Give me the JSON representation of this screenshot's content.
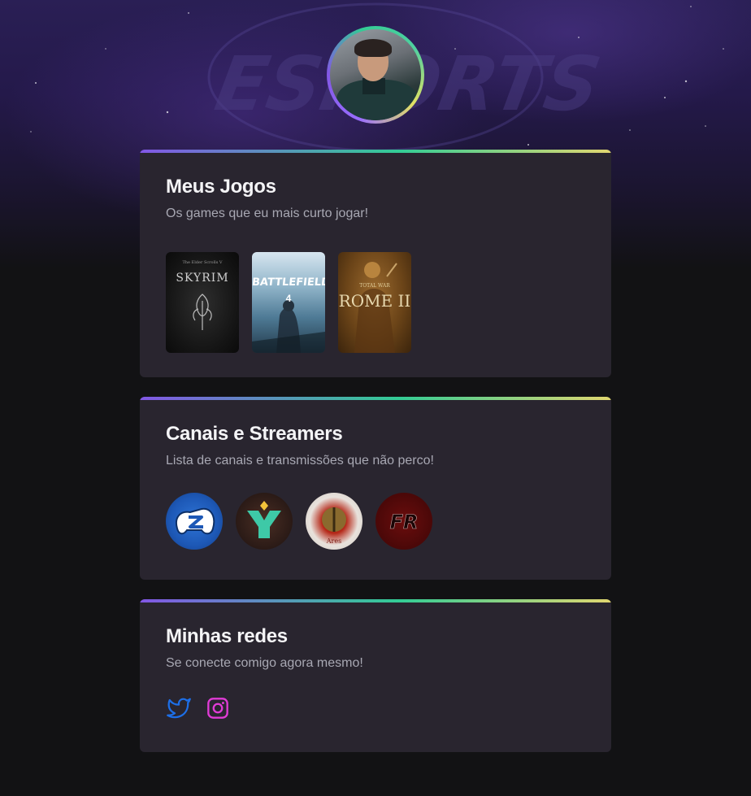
{
  "profile": {
    "avatar_alt": "Foto de perfil"
  },
  "colors": {
    "accent_purple": "#8257e5",
    "accent_green": "#33cc95",
    "accent_yellow": "#e1d770",
    "card_bg": "#29252f",
    "twitter_blue": "#1d6fe8",
    "instagram_pink": "#e13bd6"
  },
  "games_card": {
    "title": "Meus Jogos",
    "subtitle": "Os games que eu mais curto jogar!",
    "games": [
      {
        "icon": "skyrim-cover",
        "title": "SKYRIM",
        "caption": "The Elder Scrolls V"
      },
      {
        "icon": "battlefield-4-cover",
        "title": "BATTLEFIELD",
        "caption": "4"
      },
      {
        "icon": "rome-2-cover",
        "title": "ROME II",
        "caption": "TOTAL WAR"
      }
    ]
  },
  "streamers_card": {
    "title": "Canais e Streamers",
    "subtitle": "Lista de canais e transmissões que não perco!",
    "channels": [
      {
        "icon": "zangado-channel-logo"
      },
      {
        "icon": "gaules-channel-logo"
      },
      {
        "icon": "ares-channel-logo",
        "label": "Ares"
      },
      {
        "icon": "fr-channel-logo",
        "label": "FR"
      }
    ]
  },
  "social_card": {
    "title": "Minhas redes",
    "subtitle": "Se conecte comigo agora mesmo!",
    "links": [
      {
        "icon": "twitter-icon"
      },
      {
        "icon": "instagram-icon"
      }
    ]
  }
}
